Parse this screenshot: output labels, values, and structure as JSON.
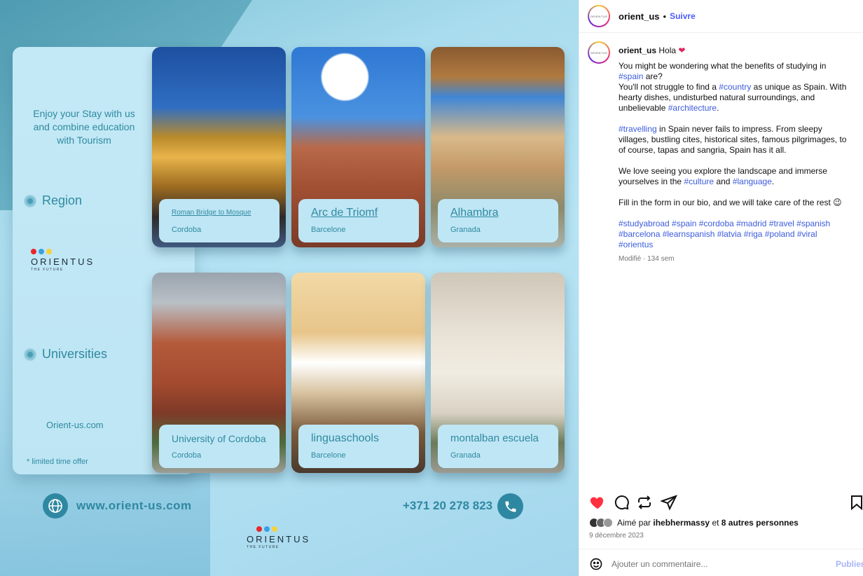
{
  "post": {
    "tagline": "Enjoy your Stay with us and combine education with Tourism",
    "region_label": "Region",
    "universities_label": "Universities",
    "site_small": "Orient-us.com",
    "limited": "* limited time offer",
    "logo": {
      "word": "ORIENTUS",
      "sub": "THE FUTURE",
      "dots": [
        "#e8262b",
        "#3aa0e0",
        "#f5d23a"
      ]
    },
    "tiles": [
      {
        "title": "Roman Bridge to Mosque",
        "sub": "Cordoba"
      },
      {
        "title": "Arc de Triomf",
        "sub": "Barcelone"
      },
      {
        "title": "Alhambra",
        "sub": "Granada"
      },
      {
        "title": "University of Cordoba",
        "sub": "Cordoba"
      },
      {
        "title": "linguaschools",
        "sub": "Barcelone"
      },
      {
        "title": "montalban escuela",
        "sub": "Granada"
      }
    ],
    "website": "www.orient-us.com",
    "phone": "+371 20 278 823",
    "accent": "#2f88a1"
  },
  "panel": {
    "username": "orient_us",
    "dot": "•",
    "follow": "Suivre",
    "caption": {
      "greeting": "Hola",
      "p1a": "You might be wondering what the benefits of studying in",
      "tag_spain": "#spain",
      "p1b": "are?",
      "p1c": "You'll not struggle to find a",
      "tag_country": "#country",
      "p1d": "as unique as Spain. With hearty dishes, undisturbed natural surroundings, and unbelievable",
      "tag_architecture": "#architecture",
      "tag_travelling": "#travelling",
      "p2": "in Spain never fails to impress. From sleepy villages, bustling cites, historical sites, famous pilgrimages, to of course, tapas and sangria, Spain has it all.",
      "p3a": "We love seeing you explore the landscape and immerse yourselves in the",
      "tag_culture": "#culture",
      "and": "and",
      "tag_language": "#language",
      "p4": "Fill in the form in our bio, and we will take care of the rest 😉",
      "hashtags": "#studyabroad #spain #cordoba #madrid #travel #spanish #barcelona #learnspanish #latvia #riga #poland #viral #orientus",
      "meta": "Modifié · 134 sem"
    },
    "likes_prefix": "Aimé par",
    "likes_user": "ihebhermassy",
    "likes_suffix": "et",
    "likes_others": "8 autres personnes",
    "date": "9 décembre 2023",
    "comment_placeholder": "Ajouter un commentaire...",
    "publish": "Publier"
  }
}
